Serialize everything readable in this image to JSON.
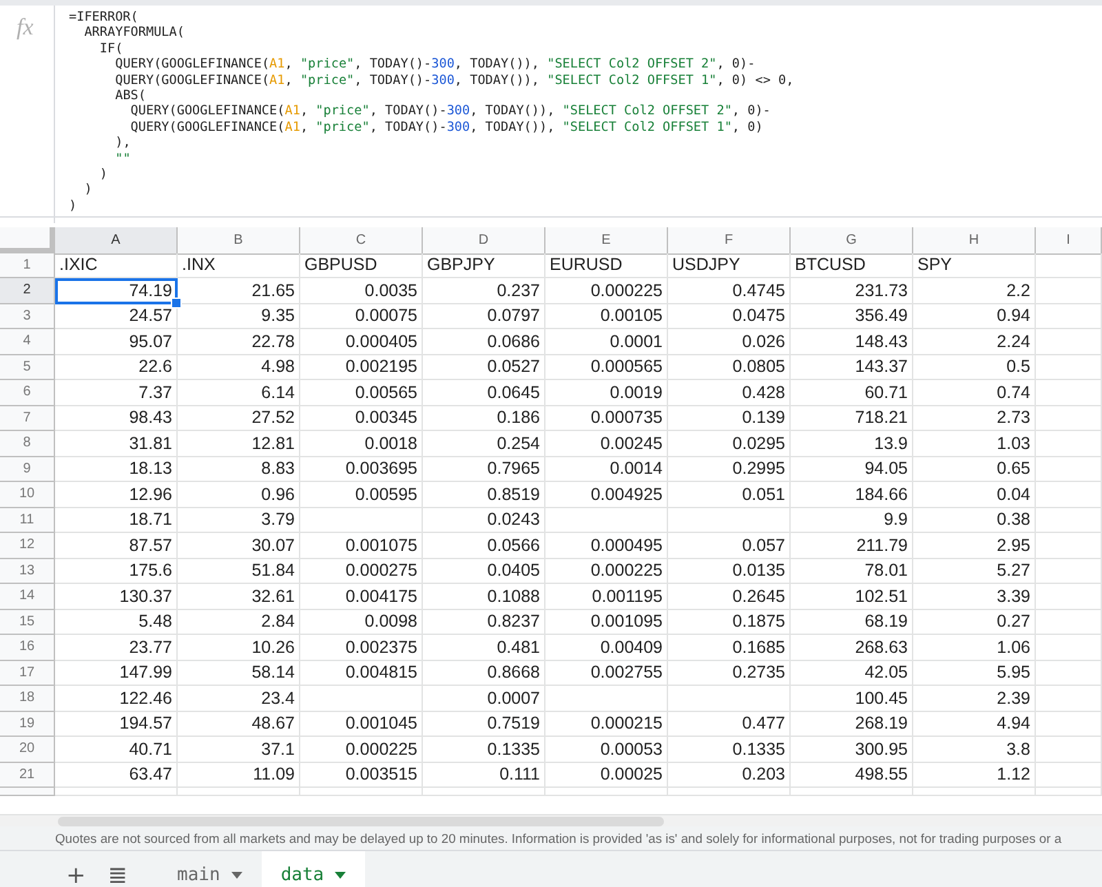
{
  "formula_bar": {
    "icon_label": "fx",
    "lines": [
      [
        {
          "kind": "plain",
          "text": "=IFERROR("
        }
      ],
      [
        {
          "kind": "plain",
          "text": "  ARRAYFORMULA("
        }
      ],
      [
        {
          "kind": "plain",
          "text": "    IF("
        }
      ],
      [
        {
          "kind": "plain",
          "text": "      QUERY(GOOGLEFINANCE("
        },
        {
          "kind": "ref",
          "text": "A1"
        },
        {
          "kind": "plain",
          "text": ", "
        },
        {
          "kind": "string",
          "text": "\"price\""
        },
        {
          "kind": "plain",
          "text": ", TODAY()-"
        },
        {
          "kind": "number",
          "text": "300"
        },
        {
          "kind": "plain",
          "text": ", TODAY()), "
        },
        {
          "kind": "string",
          "text": "\"SELECT Col2 OFFSET 2\""
        },
        {
          "kind": "plain",
          "text": ", 0)-"
        }
      ],
      [
        {
          "kind": "plain",
          "text": "      QUERY(GOOGLEFINANCE("
        },
        {
          "kind": "ref",
          "text": "A1"
        },
        {
          "kind": "plain",
          "text": ", "
        },
        {
          "kind": "string",
          "text": "\"price\""
        },
        {
          "kind": "plain",
          "text": ", TODAY()-"
        },
        {
          "kind": "number",
          "text": "300"
        },
        {
          "kind": "plain",
          "text": ", TODAY()), "
        },
        {
          "kind": "string",
          "text": "\"SELECT Col2 OFFSET 1\""
        },
        {
          "kind": "plain",
          "text": ", 0) <> 0,"
        }
      ],
      [
        {
          "kind": "plain",
          "text": "      ABS("
        }
      ],
      [
        {
          "kind": "plain",
          "text": "        QUERY(GOOGLEFINANCE("
        },
        {
          "kind": "ref",
          "text": "A1"
        },
        {
          "kind": "plain",
          "text": ", "
        },
        {
          "kind": "string",
          "text": "\"price\""
        },
        {
          "kind": "plain",
          "text": ", TODAY()-"
        },
        {
          "kind": "number",
          "text": "300"
        },
        {
          "kind": "plain",
          "text": ", TODAY()), "
        },
        {
          "kind": "string",
          "text": "\"SELECT Col2 OFFSET 2\""
        },
        {
          "kind": "plain",
          "text": ", 0)-"
        }
      ],
      [
        {
          "kind": "plain",
          "text": "        QUERY(GOOGLEFINANCE("
        },
        {
          "kind": "ref",
          "text": "A1"
        },
        {
          "kind": "plain",
          "text": ", "
        },
        {
          "kind": "string",
          "text": "\"price\""
        },
        {
          "kind": "plain",
          "text": ", TODAY()-"
        },
        {
          "kind": "number",
          "text": "300"
        },
        {
          "kind": "plain",
          "text": ", TODAY()), "
        },
        {
          "kind": "string",
          "text": "\"SELECT Col2 OFFSET 1\""
        },
        {
          "kind": "plain",
          "text": ", 0)"
        }
      ],
      [
        {
          "kind": "plain",
          "text": "      ),"
        }
      ],
      [
        {
          "kind": "string",
          "text": "      \"\""
        }
      ],
      [
        {
          "kind": "plain",
          "text": "    )"
        }
      ],
      [
        {
          "kind": "plain",
          "text": "  )"
        }
      ],
      [
        {
          "kind": "plain",
          "text": ")"
        }
      ]
    ]
  },
  "table": {
    "columns": [
      {
        "letter": "A",
        "selected": true
      },
      {
        "letter": "B",
        "selected": false
      },
      {
        "letter": "C",
        "selected": false
      },
      {
        "letter": "D",
        "selected": false
      },
      {
        "letter": "E",
        "selected": false
      },
      {
        "letter": "F",
        "selected": false
      },
      {
        "letter": "G",
        "selected": false
      },
      {
        "letter": "H",
        "selected": false
      },
      {
        "letter": "I",
        "selected": false
      }
    ],
    "rows": [
      {
        "number": "1",
        "kind": "labels",
        "selected": false,
        "cells": [
          ".IXIC",
          ".INX",
          "GBPUSD",
          "GBPJPY",
          "EURUSD",
          "USDJPY",
          "BTCUSD",
          "SPY"
        ]
      },
      {
        "number": "2",
        "kind": "values",
        "selected": true,
        "cells": [
          "74.19",
          "21.65",
          "0.0035",
          "0.237",
          "0.000225",
          "0.4745",
          "231.73",
          "2.2"
        ]
      },
      {
        "number": "3",
        "kind": "values",
        "selected": false,
        "cells": [
          "24.57",
          "9.35",
          "0.00075",
          "0.0797",
          "0.00105",
          "0.0475",
          "356.49",
          "0.94"
        ]
      },
      {
        "number": "4",
        "kind": "values",
        "selected": false,
        "cells": [
          "95.07",
          "22.78",
          "0.000405",
          "0.0686",
          "0.0001",
          "0.026",
          "148.43",
          "2.24"
        ]
      },
      {
        "number": "5",
        "kind": "values",
        "selected": false,
        "cells": [
          "22.6",
          "4.98",
          "0.002195",
          "0.0527",
          "0.000565",
          "0.0805",
          "143.37",
          "0.5"
        ]
      },
      {
        "number": "6",
        "kind": "values",
        "selected": false,
        "cells": [
          "7.37",
          "6.14",
          "0.00565",
          "0.0645",
          "0.0019",
          "0.428",
          "60.71",
          "0.74"
        ]
      },
      {
        "number": "7",
        "kind": "values",
        "selected": false,
        "cells": [
          "98.43",
          "27.52",
          "0.00345",
          "0.186",
          "0.000735",
          "0.139",
          "718.21",
          "2.73"
        ]
      },
      {
        "number": "8",
        "kind": "values",
        "selected": false,
        "cells": [
          "31.81",
          "12.81",
          "0.0018",
          "0.254",
          "0.00245",
          "0.0295",
          "13.9",
          "1.03"
        ]
      },
      {
        "number": "9",
        "kind": "values",
        "selected": false,
        "cells": [
          "18.13",
          "8.83",
          "0.003695",
          "0.7965",
          "0.0014",
          "0.2995",
          "94.05",
          "0.65"
        ]
      },
      {
        "number": "10",
        "kind": "values",
        "selected": false,
        "cells": [
          "12.96",
          "0.96",
          "0.00595",
          "0.8519",
          "0.004925",
          "0.051",
          "184.66",
          "0.04"
        ]
      },
      {
        "number": "11",
        "kind": "values",
        "selected": false,
        "cells": [
          "18.71",
          "3.79",
          null,
          "0.0243",
          null,
          null,
          "9.9",
          "0.38"
        ]
      },
      {
        "number": "12",
        "kind": "values",
        "selected": false,
        "cells": [
          "87.57",
          "30.07",
          "0.001075",
          "0.0566",
          "0.000495",
          "0.057",
          "211.79",
          "2.95"
        ]
      },
      {
        "number": "13",
        "kind": "values",
        "selected": false,
        "cells": [
          "175.6",
          "51.84",
          "0.000275",
          "0.0405",
          "0.000225",
          "0.0135",
          "78.01",
          "5.27"
        ]
      },
      {
        "number": "14",
        "kind": "values",
        "selected": false,
        "cells": [
          "130.37",
          "32.61",
          "0.004175",
          "0.1088",
          "0.001195",
          "0.2645",
          "102.51",
          "3.39"
        ]
      },
      {
        "number": "15",
        "kind": "values",
        "selected": false,
        "cells": [
          "5.48",
          "2.84",
          "0.0098",
          "0.8237",
          "0.001095",
          "0.1875",
          "68.19",
          "0.27"
        ]
      },
      {
        "number": "16",
        "kind": "values",
        "selected": false,
        "cells": [
          "23.77",
          "10.26",
          "0.002375",
          "0.481",
          "0.00409",
          "0.1685",
          "268.63",
          "1.06"
        ]
      },
      {
        "number": "17",
        "kind": "values",
        "selected": false,
        "cells": [
          "147.99",
          "58.14",
          "0.004815",
          "0.8668",
          "0.002755",
          "0.2735",
          "42.05",
          "5.95"
        ]
      },
      {
        "number": "18",
        "kind": "values",
        "selected": false,
        "cells": [
          "122.46",
          "23.4",
          null,
          "0.0007",
          null,
          null,
          "100.45",
          "2.39"
        ]
      },
      {
        "number": "19",
        "kind": "values",
        "selected": false,
        "cells": [
          "194.57",
          "48.67",
          "0.001045",
          "0.7519",
          "0.000215",
          "0.477",
          "268.19",
          "4.94"
        ]
      },
      {
        "number": "20",
        "kind": "values",
        "selected": false,
        "cells": [
          "40.71",
          "37.1",
          "0.000225",
          "0.1335",
          "0.00053",
          "0.1335",
          "300.95",
          "3.8"
        ]
      },
      {
        "number": "21",
        "kind": "values",
        "selected": false,
        "cells": [
          "63.47",
          "11.09",
          "0.003515",
          "0.111",
          "0.00025",
          "0.203",
          "498.55",
          "1.12"
        ]
      }
    ]
  },
  "notice": "Quotes are not sourced from all markets and may be delayed up to 20 minutes. Information is provided 'as is' and solely for informational purposes, not for trading purposes or a",
  "sheet_bar": {
    "add_button": "+",
    "list_button": "≣",
    "tabs": [
      {
        "label": "main",
        "selected": false
      },
      {
        "label": "data",
        "selected": true
      }
    ]
  }
}
